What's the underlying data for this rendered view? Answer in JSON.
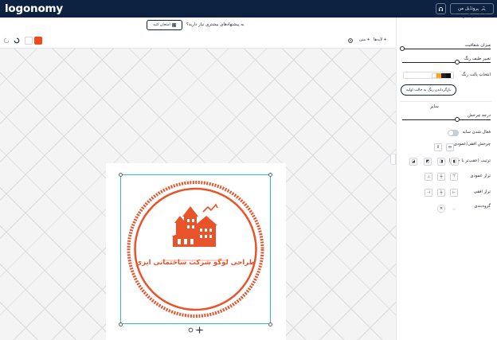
{
  "header": {
    "logo": "logonomy",
    "profile_label": "پروفایل من"
  },
  "sidebar": {
    "title": "تنظیمات",
    "subtitle": "تنظیمات رنگ و شفافیت",
    "opacity_label": "میزان شفافیت",
    "hue_label": "تغییر طیف رنگ",
    "palette_label": "انتخاب پالت رنگ",
    "palette_colors": [
      "#111111",
      "#222222",
      "#f5a623",
      "#ffffff"
    ],
    "save_button": "بازگرداندن رنگ به حالت اولیه",
    "other_section": "سایر",
    "rotation_label": "درجه چرخش",
    "shadow_label": "فعال شدن سایه",
    "flip_label": "چرخش افقی/عمودی",
    "order_label": "ترتیب (عقب‌تر یا جلوتر)",
    "vertical_align_label": "تراز عمودی",
    "horizontal_align_label": "تراز افقی",
    "group_label": "گروه‌بندی"
  },
  "toolbar": {
    "suggest_button": "امتحان کنید",
    "suggest_text": "به پیشنهادهای بیشتری نیاز دارید؟",
    "layers_label": "لایه‌ها",
    "text_label": "متن",
    "accent_color": "#f04a1a"
  },
  "logo": {
    "text": "طراحی لوگو شرکت ساختمانی ایزی"
  }
}
